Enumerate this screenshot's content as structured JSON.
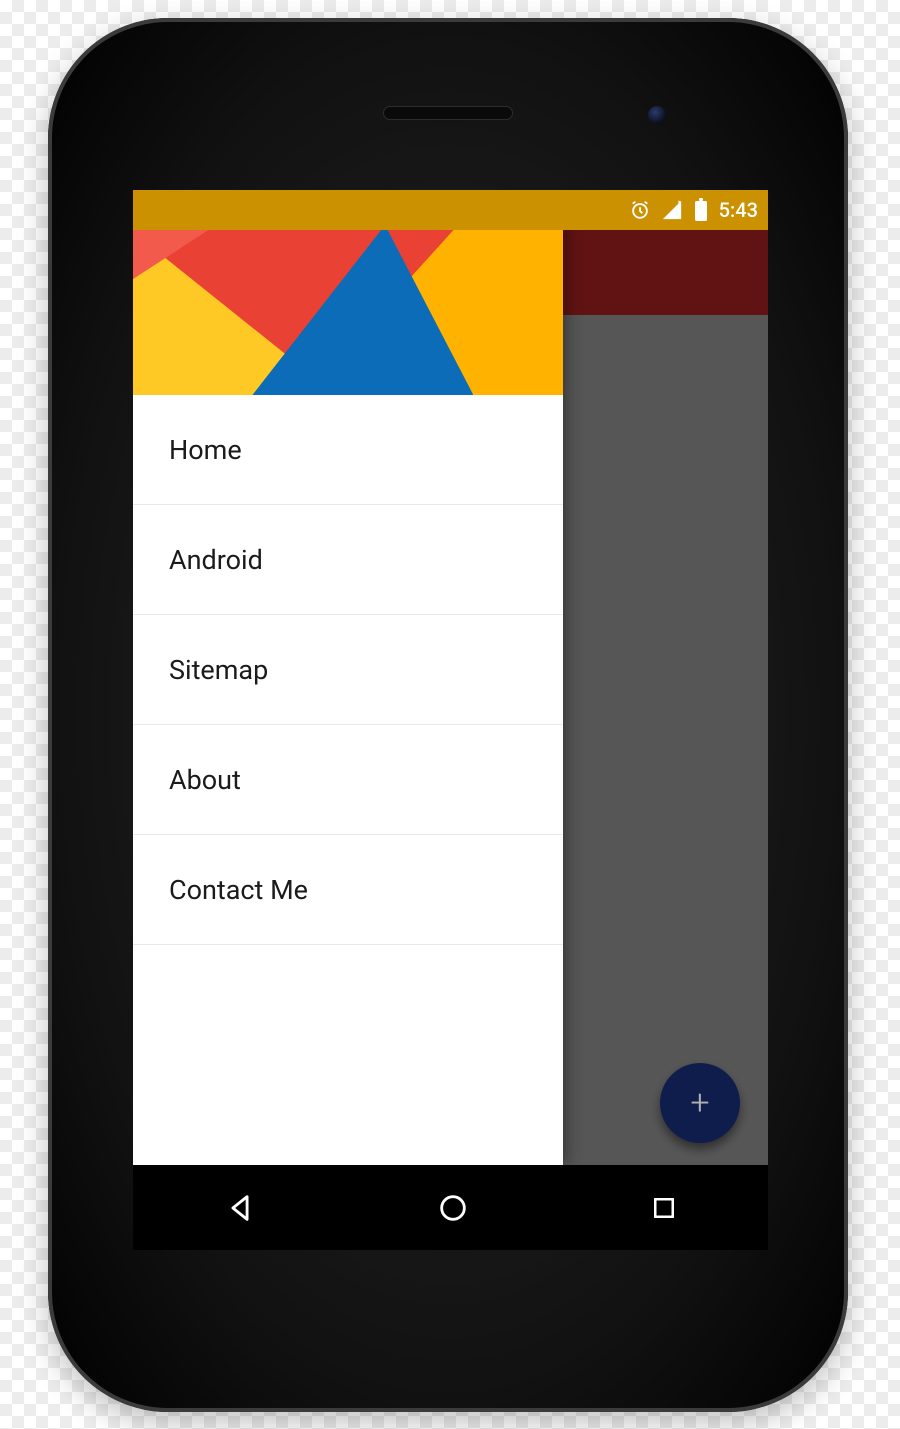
{
  "statusbar": {
    "time": "5:43",
    "icons": {
      "alarm": "alarm-icon",
      "signal": "signal-icon",
      "battery": "battery-icon"
    }
  },
  "appbar": {
    "color": "#8b1c1c"
  },
  "fab": {
    "label": "+",
    "color": "#162a6d"
  },
  "drawer": {
    "header_colors": {
      "red": "#e94134",
      "orange": "#ffc925",
      "blue": "#0d6cb7"
    },
    "items": [
      {
        "label": "Home"
      },
      {
        "label": "Android"
      },
      {
        "label": "Sitemap"
      },
      {
        "label": "About"
      },
      {
        "label": "Contact Me"
      }
    ]
  },
  "navbar": {
    "back": "back-icon",
    "home": "home-icon",
    "recents": "recents-icon"
  }
}
